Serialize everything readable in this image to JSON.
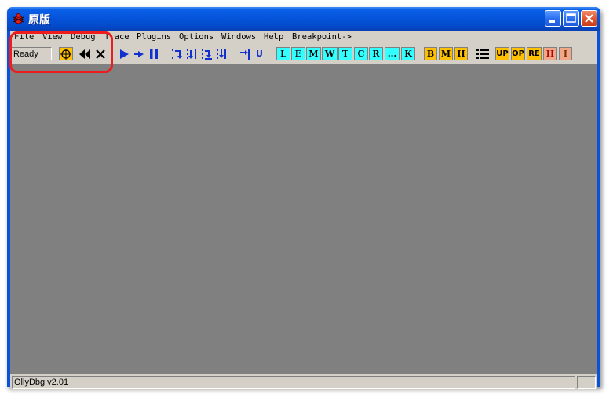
{
  "window": {
    "title": "原版"
  },
  "menu": [
    "File",
    "View",
    "Debug",
    "Trace",
    "Plugins",
    "Options",
    "Windows",
    "Help",
    "Breakpoint->"
  ],
  "toolbar": {
    "status": "Ready",
    "buttons": [
      {
        "name": "open-button",
        "icon": "crosshair-icon",
        "label": ""
      },
      {
        "name": "restart-button",
        "icon": "rewind-icon",
        "label": ""
      },
      {
        "name": "close-program-button",
        "icon": "close-icon",
        "label": ""
      },
      {
        "name": "run-button",
        "icon": "play-icon",
        "label": ""
      },
      {
        "name": "run-thread-button",
        "icon": "run-thread-icon",
        "label": ""
      },
      {
        "name": "pause-button",
        "icon": "pause-icon",
        "label": ""
      },
      {
        "name": "step-into-button",
        "icon": "step-into-icon",
        "label": ""
      },
      {
        "name": "step-over-button",
        "icon": "step-over-icon",
        "label": ""
      },
      {
        "name": "trace-into-button",
        "icon": "trace-into-icon",
        "label": ""
      },
      {
        "name": "trace-over-button",
        "icon": "trace-over-icon",
        "label": ""
      },
      {
        "name": "execute-till-return-button",
        "icon": "till-return-icon",
        "label": ""
      },
      {
        "name": "execute-till-user-code-button",
        "icon": "till-user-icon",
        "label": "U"
      }
    ],
    "windows": [
      "L",
      "E",
      "M",
      "W",
      "T",
      "C",
      "R",
      "...",
      "K"
    ],
    "breakpoints": [
      "B",
      "M",
      "H"
    ],
    "extra": [
      "UP",
      "OP",
      "RE",
      "H",
      "I"
    ]
  },
  "statusbar": {
    "text": "OllyDbg v2.01"
  },
  "colors": {
    "titlebar": "#0553d9",
    "cyan": "#33ffff",
    "gold": "#ffc000",
    "salmon": "#f0a88a",
    "highlight": "#ee1c1c"
  }
}
